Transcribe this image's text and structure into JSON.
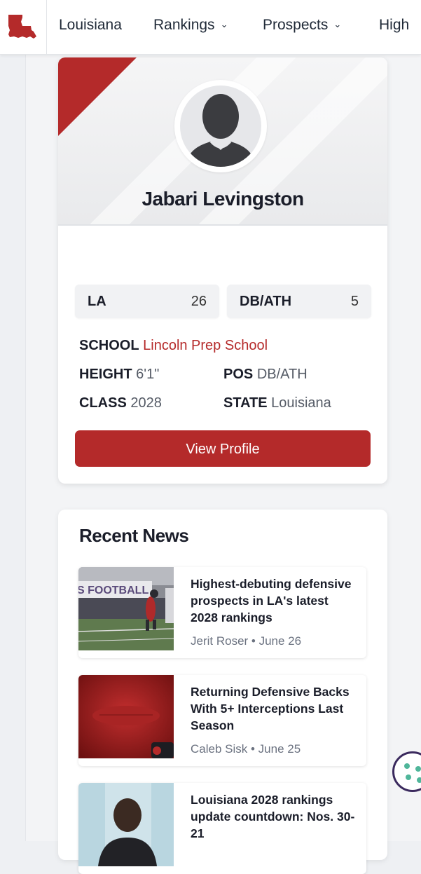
{
  "nav": {
    "items": [
      {
        "label": "Louisiana",
        "dropdown": false
      },
      {
        "label": "Rankings",
        "dropdown": true
      },
      {
        "label": "Prospects",
        "dropdown": true
      },
      {
        "label": "High",
        "dropdown": false
      }
    ]
  },
  "profile": {
    "name": "Jabari Levingston",
    "rankings": [
      {
        "label": "LA",
        "value": "26"
      },
      {
        "label": "DB/ATH",
        "value": "5"
      }
    ],
    "school_label": "SCHOOL",
    "school": "Lincoln Prep School",
    "height_label": "HEIGHT",
    "height": "6'1\"",
    "pos_label": "POS",
    "pos": "DB/ATH",
    "class_label": "CLASS",
    "class": "2028",
    "state_label": "STATE",
    "state": "Louisiana",
    "button": "View Profile"
  },
  "news": {
    "title": "Recent News",
    "items": [
      {
        "headline": "Highest-debuting defensive prospects in LA's latest 2028 rankings",
        "author": "Jerit Roser",
        "date": "June 26"
      },
      {
        "headline": "Returning Defensive Backs With 5+ Interceptions Last Season",
        "author": "Caleb Sisk",
        "date": "June 25"
      },
      {
        "headline": "Louisiana 2028 rankings update countdown: Nos. 30-21",
        "author": "",
        "date": ""
      }
    ]
  },
  "colors": {
    "accent": "#b42a2a",
    "text": "#1a1d29"
  }
}
